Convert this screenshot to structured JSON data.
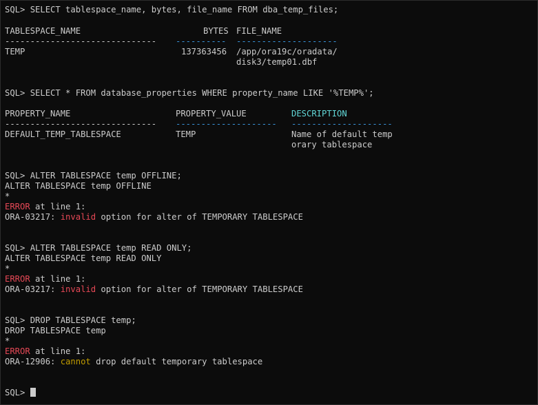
{
  "terminal": {
    "q1": {
      "prompt": "SQL> ",
      "command": "SELECT tablespace_name, bytes, file_name FROM dba_temp_files;",
      "header": {
        "c1": "TABLESPACE_NAME",
        "c2": "BYTES",
        "c3": "FILE_NAME"
      },
      "separator": {
        "s1": "------------------------------",
        "s2": "----------",
        "s3": "--------------------"
      },
      "row": {
        "c1": "TEMP",
        "c2": "137363456",
        "c3": "/app/ora19c/oradata/",
        "c3_cont": "disk3/temp01.dbf"
      }
    },
    "q2": {
      "prompt": "SQL> ",
      "command": "SELECT * FROM database_properties WHERE property_name LIKE '%TEMP%';",
      "header": {
        "c1": "PROPERTY_NAME",
        "c2": "PROPERTY_VALUE",
        "c3": "DESCRIPTION"
      },
      "separator": {
        "s1": "------------------------------",
        "s2": "--------------------",
        "s3": "--------------------"
      },
      "row": {
        "c1": "DEFAULT_TEMP_TABLESPACE",
        "c2": "TEMP",
        "c3": "Name of default temp",
        "c3_cont": "orary tablespace"
      }
    },
    "q3": {
      "prompt": "SQL> ",
      "command": "ALTER TABLESPACE temp OFFLINE;",
      "echo": "ALTER TABLESPACE temp OFFLINE",
      "marker": "*",
      "error_word": "ERROR",
      "error_rest": " at line 1:",
      "ora_code": "ORA-03217: ",
      "ora_keyword": "invalid",
      "ora_rest": " option for alter of TEMPORARY TABLESPACE"
    },
    "q4": {
      "prompt": "SQL> ",
      "command": "ALTER TABLESPACE temp READ ONLY;",
      "echo": "ALTER TABLESPACE temp READ ONLY",
      "marker": "*",
      "error_word": "ERROR",
      "error_rest": " at line 1:",
      "ora_code": "ORA-03217: ",
      "ora_keyword": "invalid",
      "ora_rest": " option for alter of TEMPORARY TABLESPACE"
    },
    "q5": {
      "prompt": "SQL> ",
      "command": "DROP TABLESPACE temp;",
      "echo": "DROP TABLESPACE temp",
      "marker": "*",
      "error_word": "ERROR",
      "error_rest": " at line 1:",
      "ora_code": "ORA-12906: ",
      "ora_keyword": "cannot",
      "ora_rest": " drop default temporary tablespace"
    },
    "final_prompt": "SQL> ",
    "colors": {
      "background": "#0c0c0c",
      "foreground": "#cccccc",
      "error": "#e74856",
      "keyword_invalid": "#e74856",
      "keyword_cannot": "#c19c00",
      "highlight_header": "#61d6d6",
      "highlight_separator": "#3a96dd"
    }
  }
}
